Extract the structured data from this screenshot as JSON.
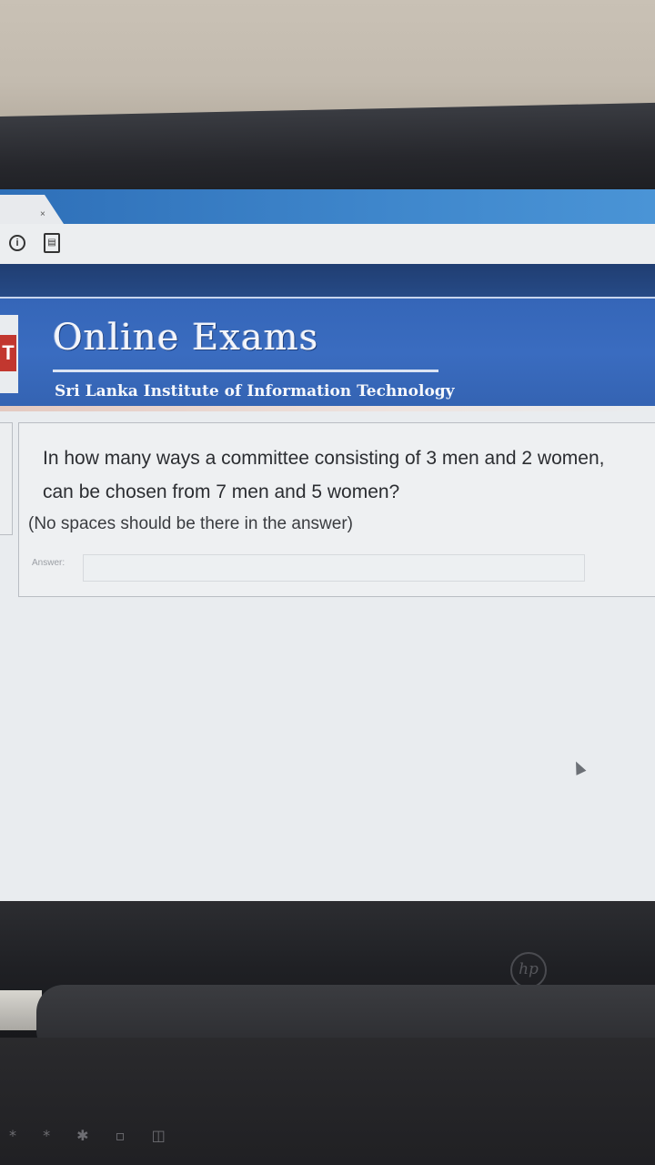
{
  "browser": {
    "tab_close_glyph": "×",
    "info_icon_glyph": "i",
    "page_icon_glyph": "▤"
  },
  "header": {
    "title": "Online Exams",
    "subtitle": "Sri Lanka Institute of Information Technology",
    "logo_letter": "T"
  },
  "question": {
    "text": "In how many ways a committee consisting of 3 men and 2 women, can be chosen from 7 men and 5 women?",
    "note": "(No spaces should be there in the answer)",
    "answer_label": "Answer:",
    "answer_value": ""
  },
  "device": {
    "brand": "hp",
    "keys": "* * ✱ ▫ ◫"
  },
  "colors": {
    "header_blue": "#3566b8",
    "tab_blue": "#3f87cc",
    "logo_red": "#c2372f"
  }
}
